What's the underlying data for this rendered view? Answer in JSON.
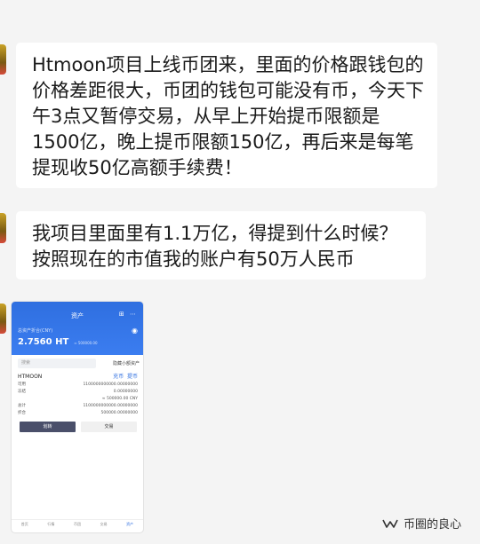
{
  "messages": [
    {
      "text": "Htmoon项目上线币团来，里面的价格跟钱包的价格差距很大，币团的钱包可能没有币，今天下午3点又暂停交易，从早上开始提币限额是1500亿，晚上提币限额150亿，再后来是每笔提现收50亿高额手续费！"
    },
    {
      "text": "我项目里面里有1.1万亿，得提到什么时候？按照现在的市值我的账户有50万人民币"
    }
  ],
  "screenshot": {
    "header_title": "资产",
    "header_icons": "⊞ ⋯",
    "eye_icon": "◉",
    "balance_label": "总资产折合(CNY)",
    "balance_amount": "2.7560 HT",
    "balance_sub": "≈ 500000.00",
    "search_placeholder": "搜索",
    "search_right": "隐藏小额资产",
    "coin_symbol": "HTMOON",
    "coin_action1": "充币",
    "coin_action2": "提币",
    "rows": [
      {
        "label": "可用",
        "value": "1100000000000.00000000"
      },
      {
        "label": "冻结",
        "value": "0.00000000"
      },
      {
        "label": "",
        "value": "≈ 500000.00 CNY"
      },
      {
        "label": "总计",
        "value": "1100000000000.00000000"
      },
      {
        "label": "折合",
        "value": "500000.00000000"
      }
    ],
    "button_primary": "划转",
    "button_secondary": "交易",
    "tabs": [
      "首页",
      "行情",
      "币团",
      "交易",
      "资产"
    ]
  },
  "watermark": {
    "text": "币圈的良心",
    "icon": "wechat-channel-icon"
  },
  "colors": {
    "accent": "#2f6fe0",
    "bubble": "#ffffff",
    "background": "#f4f4f4"
  }
}
